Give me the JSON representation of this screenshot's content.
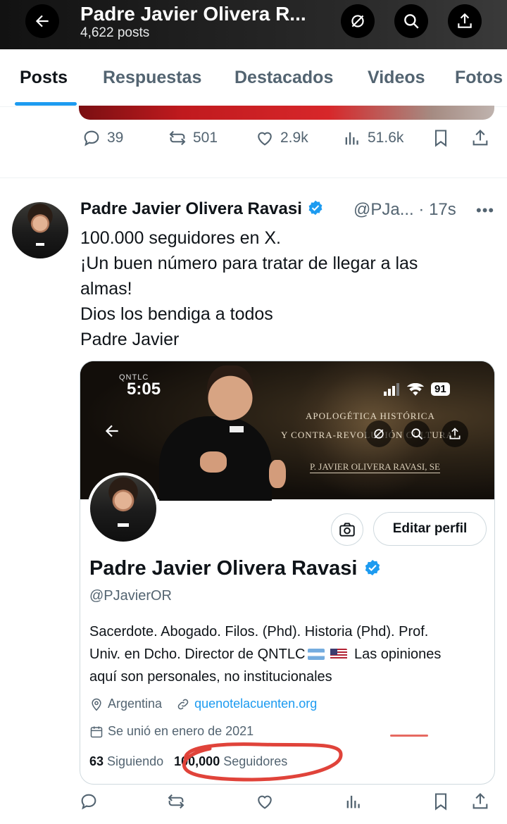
{
  "header": {
    "title": "Padre Javier Olivera R...",
    "posts_count": "4,622 posts"
  },
  "tabs": [
    {
      "label": "Posts",
      "active": true
    },
    {
      "label": "Respuestas",
      "active": false
    },
    {
      "label": "Destacados",
      "active": false
    },
    {
      "label": "Videos",
      "active": false
    },
    {
      "label": "Fotos",
      "active": false
    }
  ],
  "prev_post": {
    "replies": "39",
    "reposts": "501",
    "likes": "2.9k",
    "views": "51.6k"
  },
  "post": {
    "author": "Padre Javier Olivera Ravasi",
    "handle_time": "@PJa...",
    "time": "17s",
    "lines": [
      "100.000 seguidores en X.",
      "¡Un buen número para tratar de llegar a las",
      "almas!",
      "Dios los bendiga a todos",
      "Padre Javier"
    ]
  },
  "card": {
    "banner": {
      "carrier": "QNTLC",
      "time": "5:05",
      "battery": "91",
      "line1": "APOLOGÉTICA HISTÓRICA",
      "line2": "Y CONTRA-REVOLUCIÓN CULTURAL",
      "line3": "P. JAVIER OLIVERA RAVASI, SE"
    },
    "edit_button": "Editar perfil",
    "name": "Padre Javier Olivera Ravasi",
    "handle": "@PJavierOR",
    "bio": {
      "line1": "Sacerdote. Abogado. Filos. (Phd). Historia (Phd). Prof.",
      "line2a": "Univ. en Dcho. Director de QNTLC",
      "line2b": "Las opiniones",
      "line3": "aquí son personales, no institucionales"
    },
    "location": "Argentina",
    "website": "quenotelacuenten.org",
    "joined": "Se unió en enero de 2021",
    "following_count": "63",
    "following_label": "Siguiendo",
    "followers_count": "100,000",
    "followers_label": "Seguidores"
  },
  "colors": {
    "accent": "#1d9bf0",
    "secondary_text": "#536471",
    "annotation_red": "#e0433a"
  }
}
